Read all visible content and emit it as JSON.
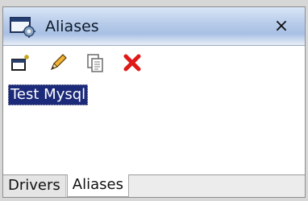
{
  "panel": {
    "title": "Aliases",
    "close_symbol": "×",
    "icon": "aliases-window-icon"
  },
  "toolbar": {
    "items": [
      {
        "icon": "new-alias-icon"
      },
      {
        "icon": "edit-pencil-icon"
      },
      {
        "icon": "copy-icon"
      },
      {
        "icon": "delete-x-icon"
      }
    ]
  },
  "list": {
    "items": [
      "Test Mysql"
    ]
  },
  "tabs": [
    {
      "label": "Drivers"
    },
    {
      "label": "Aliases"
    }
  ],
  "colors": {
    "selection_bg": "#1c2a7a",
    "delete_icon": "#e01818"
  }
}
